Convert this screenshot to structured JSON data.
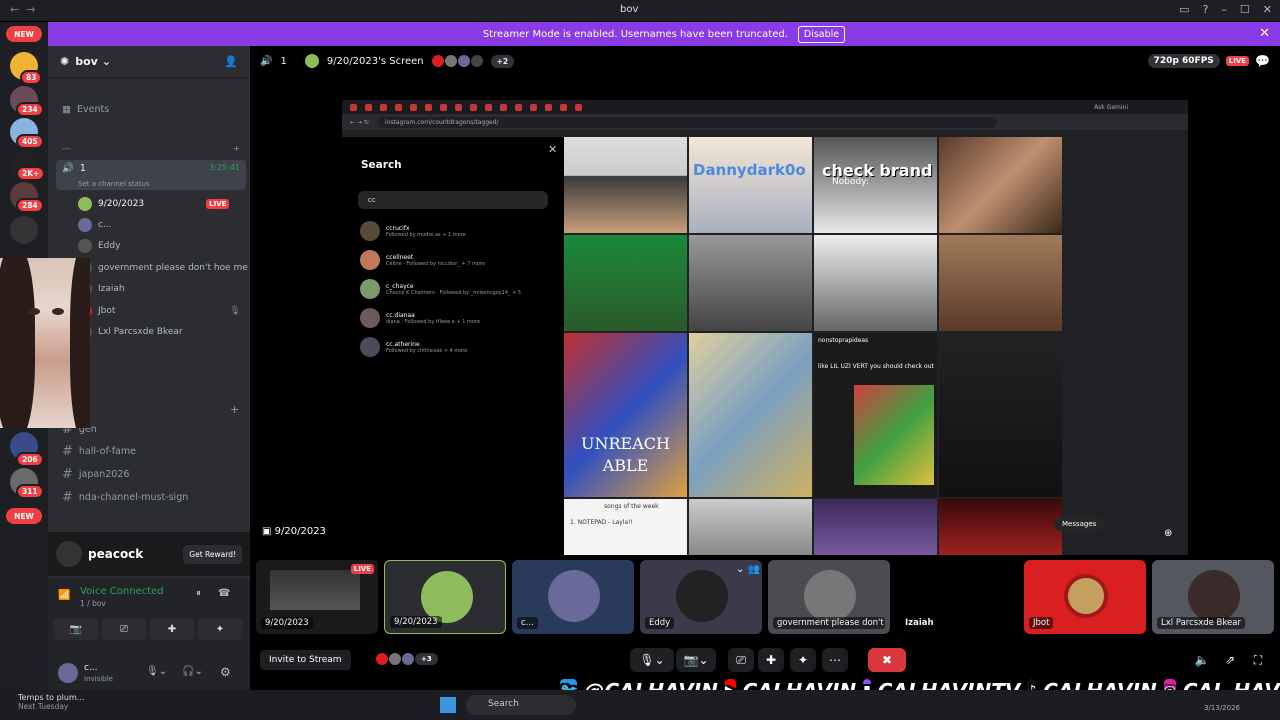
{
  "window": {
    "title": "bov"
  },
  "banner": {
    "text": "Streamer Mode is enabled. Usernames have been truncated.",
    "button": "Disable"
  },
  "guilds": {
    "badges": [
      "83",
      "234",
      "405",
      "2K+",
      "284",
      "206",
      "311"
    ],
    "new_label": "NEW"
  },
  "server": {
    "name": "bov"
  },
  "sidebar": {
    "events_label": "Events",
    "category_label": "---",
    "voice_channel": {
      "name": "1",
      "timer": "3:25:41",
      "status_hint": "Set a channel status"
    },
    "voice_users": [
      {
        "name": "9/20/2023",
        "live": "LIVE"
      },
      {
        "name": "c..."
      },
      {
        "name": "Eddy"
      },
      {
        "name": "government please don't hoe me"
      },
      {
        "name": "Izaiah"
      },
      {
        "name": "Jbot"
      },
      {
        "name": "Lxl Parcsxde Bkear"
      }
    ],
    "text_channels": [
      "gen",
      "hall-of-fame",
      "japan2026",
      "nda-channel-must-sign"
    ]
  },
  "promo": {
    "name": "peacock",
    "button": "Get Reward!"
  },
  "voice_connected": {
    "status": "Voice Connected",
    "channel": "1 / bov"
  },
  "user": {
    "name": "c...",
    "status": "Invisible"
  },
  "stage": {
    "channel_name": "1",
    "stream_title": "9/20/2023's Screen",
    "extra_viewers": "+2",
    "quality": "720p 60FPS",
    "live": "LIVE",
    "sticker_label": "9/20/2023"
  },
  "shared_screen": {
    "url": "instagram.com/countdragons/tagged/",
    "ask_label": "Ask Gemini",
    "search_title": "Search",
    "search_value": "cc",
    "results": [
      {
        "handle": "ccrucifx",
        "sub": "Followed by modre.as + 1 more",
        "color": "#5a4a3a"
      },
      {
        "handle": "ccellneet",
        "sub": "Céline · Followed by niccdior_ + 7 more",
        "color": "#c2785a"
      },
      {
        "handle": "c_chayce",
        "sub": "Chayce K Chalmers · Followed by _milesncgoy14_ + 5",
        "color": "#7a9a6a"
      },
      {
        "handle": "cc.dianaa",
        "sub": "diana · Followed by tfleee.e + 1 more",
        "color": "#6a5a5a"
      },
      {
        "handle": "cc.atherine",
        "sub": "Followed by chthisisak + 4 more",
        "color": "#4a4a5a"
      }
    ],
    "tiles_text": [
      "Dannydark0o",
      "check brand risk",
      "Nobody:",
      "UNREACH ABLE",
      "nonstoprapideas",
      "like LIL UZI VERT you should check out",
      "songs of the week",
      "1. NOTEPAD - Layla!!",
      "Messages"
    ]
  },
  "participant_tiles": [
    {
      "label": "9/20/2023",
      "live": "LIVE",
      "bg": "#1a1a1a"
    },
    {
      "label": "9/20/2023",
      "bg": "#2b2d31"
    },
    {
      "label": "c...",
      "bg": "#2a3a5a"
    },
    {
      "label": "Eddy",
      "bg": "#3a3a4a"
    },
    {
      "label": "government please don't ...",
      "bg": "#4a4c52"
    },
    {
      "label": "Izaiah",
      "bg": "#000000"
    },
    {
      "label": "Jbot",
      "bg": "#d91f1f"
    },
    {
      "label": "Lxl Parcsxde Bkear",
      "bg": "#54585e"
    }
  ],
  "controls": {
    "invite": "Invite to Stream",
    "viewer_count": "+3"
  },
  "socials": [
    {
      "icon": "twitter-icon",
      "glyph": "🐦",
      "color": "#1d9bf0",
      "handle": "@CALHAVIN"
    },
    {
      "icon": "youtube-icon",
      "glyph": "▶",
      "color": "#ff0000",
      "handle": "CALHAVIN"
    },
    {
      "icon": "twitch-icon",
      "glyph": "▮",
      "color": "#9146ff",
      "handle": "CALHAVINTV"
    },
    {
      "icon": "tiktok-icon",
      "glyph": "♪",
      "color": "#111111",
      "handle": "CALHAVIN"
    },
    {
      "icon": "instagram-icon",
      "glyph": "◎",
      "color": "#d6249f",
      "handle": "CAL.HAVIN"
    }
  ],
  "taskbar": {
    "notif_title": "Temps to plum...",
    "notif_sub": "Next Tuesday",
    "search": "Search",
    "date": "3/13/2026"
  },
  "colors": {
    "accent": "#5865f2",
    "live": "#f23f43",
    "banner": "#8a3be5",
    "voice_green": "#23a55a"
  }
}
